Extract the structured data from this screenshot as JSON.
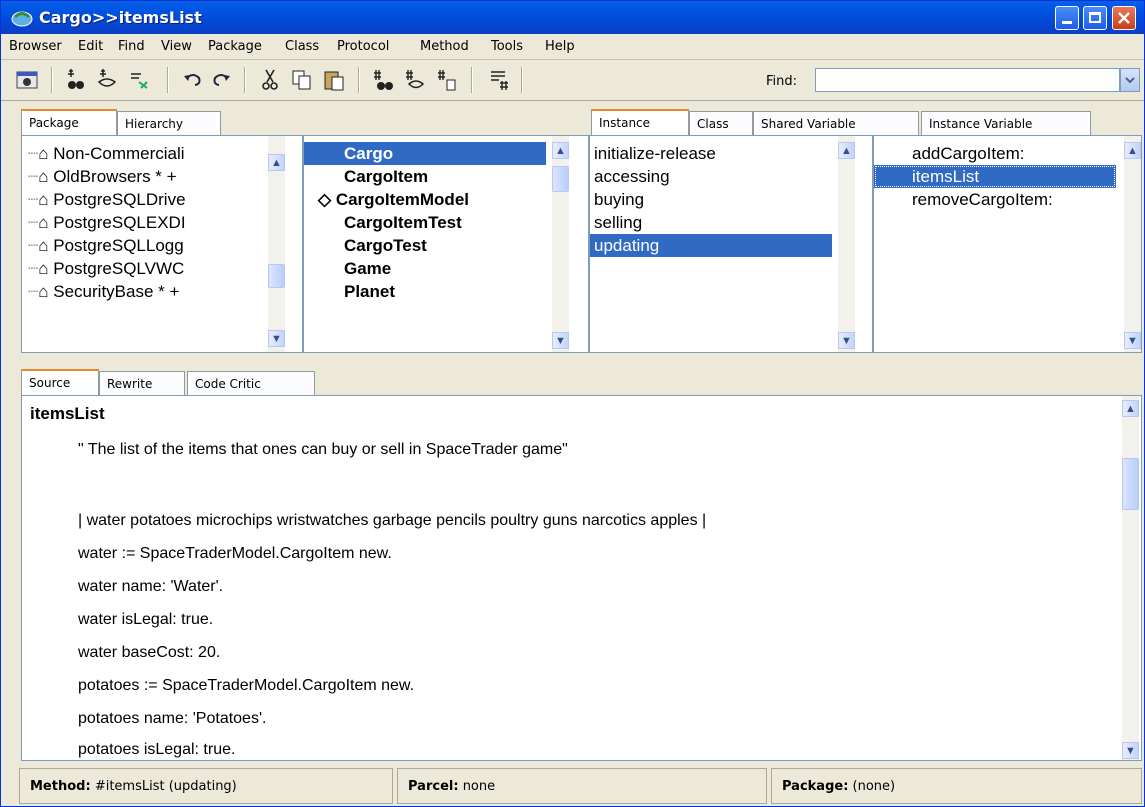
{
  "window": {
    "title": "Cargo>>itemsList"
  },
  "menu": [
    "Browser",
    "Edit",
    "Find",
    "View",
    "Package",
    "Class",
    "Protocol",
    "Method",
    "Tools",
    "Help"
  ],
  "toolbar": {
    "find_label": "Find:",
    "find_value": ""
  },
  "tabs_top_left": [
    "Package",
    "Hierarchy"
  ],
  "tabs_top_right": [
    "Instance",
    "Class",
    "Shared Variable",
    "Instance Variable"
  ],
  "packages": [
    "Non-Commerciali",
    "OldBrowsers * +",
    "PostgreSQLDrive",
    "PostgreSQLEXDI",
    "PostgreSQLLogg",
    "PostgreSQLVWC",
    "SecurityBase * +"
  ],
  "classes": [
    {
      "name": "Cargo",
      "marker": ""
    },
    {
      "name": "CargoItem",
      "marker": ""
    },
    {
      "name": "CargoItemModel",
      "marker": "◇"
    },
    {
      "name": "CargoItemTest",
      "marker": ""
    },
    {
      "name": "CargoTest",
      "marker": ""
    },
    {
      "name": "Game",
      "marker": ""
    },
    {
      "name": "Planet",
      "marker": ""
    }
  ],
  "protocols": [
    "initialize-release",
    "accessing",
    "buying",
    "selling",
    "updating"
  ],
  "methods": [
    "addCargoItem:",
    "itemsList",
    "removeCargoItem:"
  ],
  "tabs_bottom": [
    "Source",
    "Rewrite",
    "Code Critic"
  ],
  "source": {
    "title": "itemsList",
    "lines": [
      "\" The list of the items that ones can buy or sell in SpaceTrader game\"",
      "",
      "| water potatoes microchips wristwatches garbage pencils poultry guns narcotics apples |",
      "water := SpaceTraderModel.CargoItem new.",
      "water name: 'Water'.",
      "water isLegal: true.",
      "water baseCost: 20.",
      "potatoes := SpaceTraderModel.CargoItem new.",
      "potatoes name: 'Potatoes'.",
      "potatoes isLegal: true."
    ]
  },
  "status": {
    "method_label": "Method:",
    "method_value": "#itemsList (updating)",
    "parcel_label": "Parcel:",
    "parcel_value": "none",
    "package_label": "Package:",
    "package_value": "(none)"
  },
  "colors": {
    "selection": "#316ac5",
    "titlebar": "#0058e6",
    "tab_accent": "#e68b2c"
  }
}
